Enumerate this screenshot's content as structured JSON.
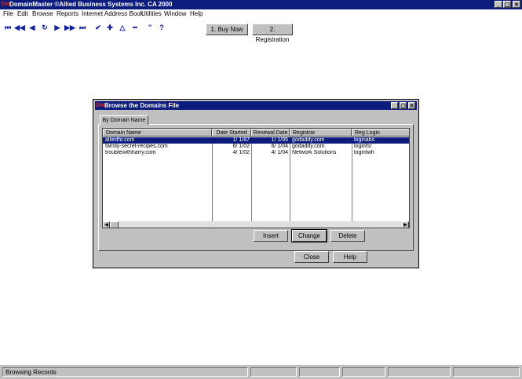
{
  "app": {
    "title": "DomainMaster ©Allied Business Systems Inc. CA 2000",
    "window_controls": [
      "_",
      "▢",
      "✕"
    ]
  },
  "menu": [
    "File",
    "Edit",
    "Browse",
    "Reports",
    "Internet Address Book",
    "Utilities",
    "Window",
    "Help"
  ],
  "toolbar": {
    "icons": [
      "first-record-icon",
      "previous-page-icon",
      "previous-record-icon",
      "refresh-icon",
      "next-record-icon",
      "next-page-icon",
      "last-record-icon",
      "check-icon",
      "add-icon",
      "triangle-icon",
      "remove-icon",
      "quote-icon",
      "help-icon"
    ],
    "buy_now": "1. Buy Now",
    "registration": "2. Registration"
  },
  "dialog": {
    "title": "Browse the Domains File",
    "tab": "By Domain Name",
    "columns": [
      "Domain Name",
      "Date Started",
      "Renewal Date",
      "Registrar",
      "Reg Login"
    ],
    "rows": [
      {
        "domain": "alliedhr.com",
        "started": "1/ 1/87",
        "renewal": "1/ 1/95",
        "registrar": "godaddy.com",
        "login": "loginabs",
        "selected": true
      },
      {
        "domain": "family-secret-recipes.com",
        "started": "6/ 1/02",
        "renewal": "6/ 1/04",
        "registrar": "godaddy.com",
        "login": "loginfsr",
        "selected": false
      },
      {
        "domain": "troublewithharry.com",
        "started": "4/ 1/02",
        "renewal": "4/ 1/04",
        "registrar": "Network Solutions",
        "login": "logintwh",
        "selected": false
      }
    ],
    "buttons": {
      "insert": "Insert",
      "change": "Change",
      "delete": "Delete",
      "close": "Close",
      "help": "Help"
    }
  },
  "status": {
    "text": "Browsing Records"
  },
  "colors": {
    "titlebar": "#0c1c7c",
    "face": "#c0c0c0",
    "selection": "#0c1c7c",
    "toolbar_icons": "#1020a0"
  }
}
